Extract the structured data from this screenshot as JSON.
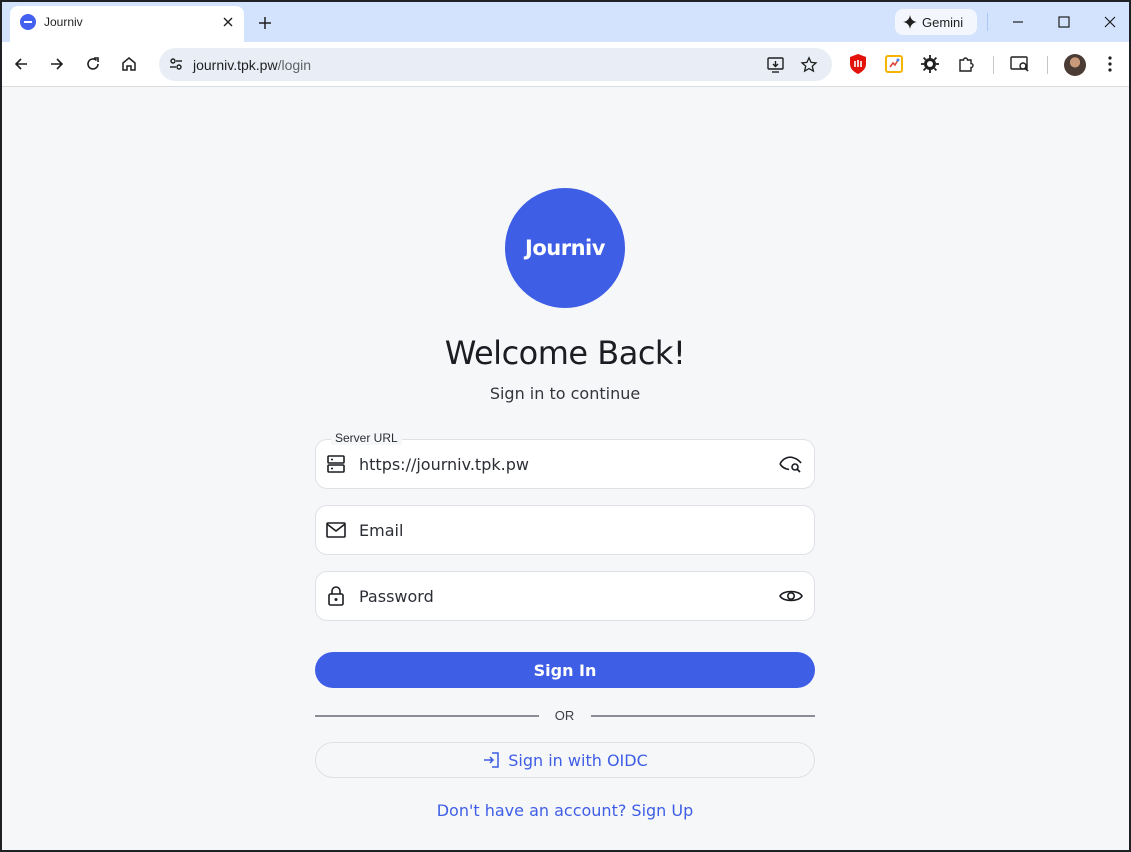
{
  "browser": {
    "tab_title": "Journiv",
    "gemini_label": "Gemini",
    "url_host": "journiv.tpk.pw",
    "url_path": "/login"
  },
  "page": {
    "logo_text": "Journiv",
    "title": "Welcome Back!",
    "subtitle": "Sign in to continue",
    "server_url_label": "Server URL",
    "server_url_value": "https://journiv.tpk.pw",
    "email_placeholder": "Email",
    "password_placeholder": "Password",
    "signin_label": "Sign In",
    "or_label": "OR",
    "oidc_label": "Sign in with OIDC",
    "signup_link": "Don't have an account? Sign Up"
  },
  "colors": {
    "accent": "#3f5ee6",
    "page_bg": "#f6f7f9",
    "tabstrip_bg": "#d3e3fd"
  }
}
